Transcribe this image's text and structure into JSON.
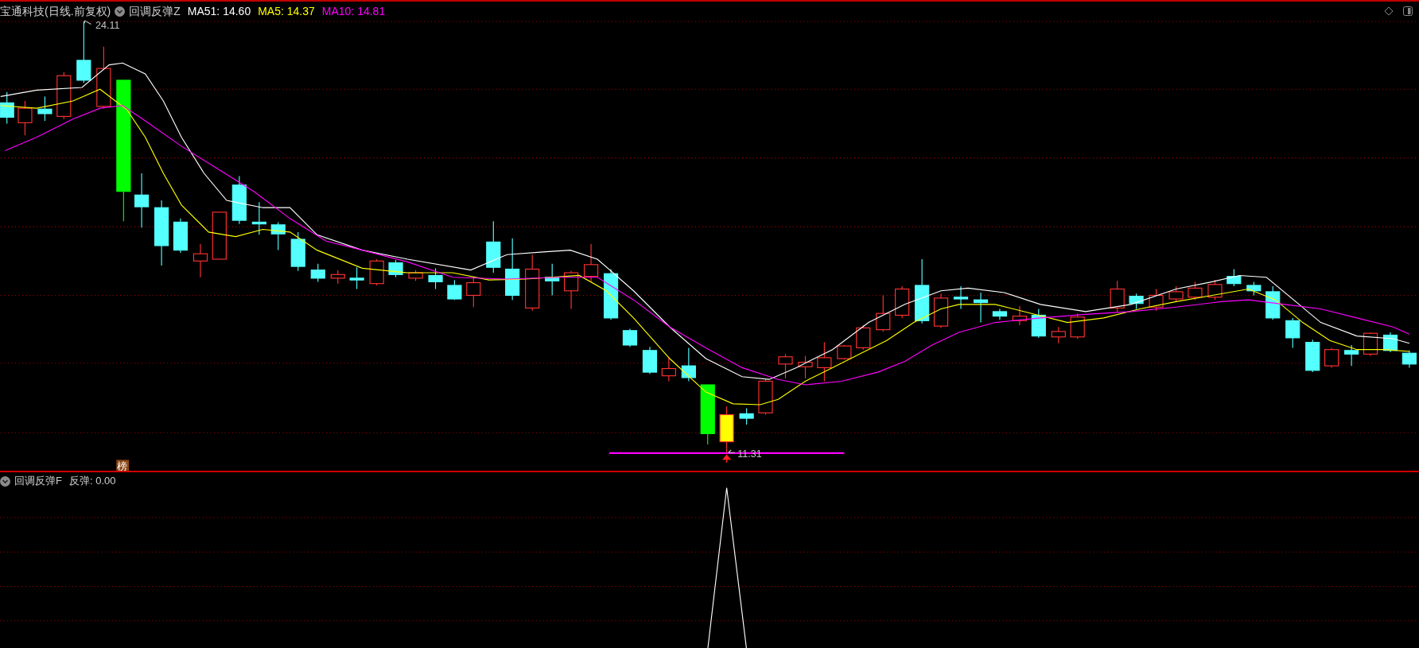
{
  "header": {
    "stock": "宝通科技(日线.前复权)",
    "indicator": "回调反弹Z",
    "values": [
      {
        "label": "MA51: 14.60",
        "color": "#ffffff"
      },
      {
        "label": "MA5: 14.37",
        "color": "#ffff00"
      },
      {
        "label": "MA10: 14.81",
        "color": "#ff00ff"
      }
    ]
  },
  "main_chart": {
    "high_label": "24.11",
    "low_label": "11.31",
    "badge": "榜"
  },
  "sub_panel": {
    "indicator": "回调反弹F",
    "reading": "反弹: 0.00"
  }
}
